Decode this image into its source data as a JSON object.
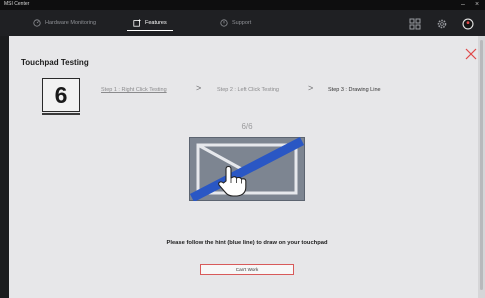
{
  "window": {
    "title": "MSI Center",
    "minimize": "–",
    "close": "×"
  },
  "nav": {
    "tabs": [
      {
        "label": "Hardware Monitoring",
        "icon": "gauge-icon"
      },
      {
        "label": "Features",
        "icon": "features-icon",
        "active": true
      },
      {
        "label": "Support",
        "icon": "support-icon"
      }
    ],
    "right_icons": [
      "grid-icon",
      "settings-gear-icon",
      "user-avatar-icon"
    ]
  },
  "panel": {
    "title": "Touchpad Testing",
    "step_number": "6",
    "steps": [
      "Step 1 : Right Click Testing",
      "Step 2 : Left Click Testing",
      "Step 3 : Drawing Line"
    ],
    "step_separator": ">",
    "progress": "6/6",
    "hint": "Please follow the hint (blue line) to draw on your touchpad",
    "cant_work_label": "Can't Work"
  },
  "colors": {
    "accent_red": "#e04848",
    "hint_line_blue": "#2a57c4",
    "touchpad_fill": "#7d8591"
  }
}
